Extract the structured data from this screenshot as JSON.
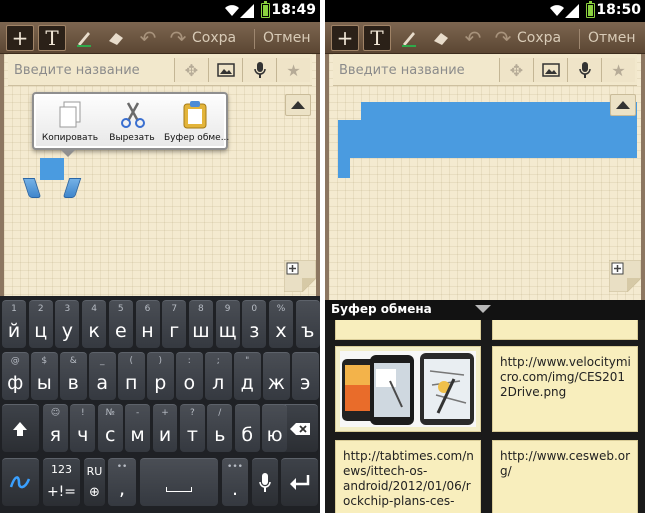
{
  "status_left": {
    "time": "18:49"
  },
  "status_right": {
    "time": "18:50"
  },
  "toolbar": {
    "add_icon": "plus-icon",
    "text_icon": "text-tool-icon",
    "pen_icon": "pen-icon",
    "eraser_icon": "eraser-icon",
    "undo_icon": "undo-icon",
    "redo_icon": "redo-icon",
    "save_label": "Сохра",
    "cancel_label": "Отмен"
  },
  "title_input": {
    "placeholder": "Введите название"
  },
  "title_icons": [
    "move-icon",
    "image-icon",
    "microphone-icon",
    "star-icon"
  ],
  "context_menu": {
    "items": [
      {
        "label": "Копировать",
        "icon": "copy-icon"
      },
      {
        "label": "Вырезать",
        "icon": "scissors-icon"
      },
      {
        "label": "Буфер обме...",
        "icon": "clipboard-icon"
      }
    ]
  },
  "keyboard": {
    "row1": [
      {
        "hint": "1",
        "key": "й"
      },
      {
        "hint": "2",
        "key": "ц"
      },
      {
        "hint": "3",
        "key": "у"
      },
      {
        "hint": "4",
        "key": "к"
      },
      {
        "hint": "5",
        "key": "е"
      },
      {
        "hint": "6",
        "key": "н"
      },
      {
        "hint": "7",
        "key": "г"
      },
      {
        "hint": "8",
        "key": "ш"
      },
      {
        "hint": "9",
        "key": "щ"
      },
      {
        "hint": "0",
        "key": "з"
      },
      {
        "hint": "%",
        "key": "х"
      },
      {
        "hint": "",
        "key": "ъ"
      }
    ],
    "row2": [
      {
        "hint": "@",
        "key": "ф"
      },
      {
        "hint": "$",
        "key": "ы"
      },
      {
        "hint": "&",
        "key": "в"
      },
      {
        "hint": "_",
        "key": "а"
      },
      {
        "hint": "(",
        "key": "п"
      },
      {
        "hint": ")",
        "key": "р"
      },
      {
        "hint": ":",
        "key": "о"
      },
      {
        "hint": ";",
        "key": "л"
      },
      {
        "hint": "\"",
        "key": "д"
      },
      {
        "hint": "",
        "key": "ж"
      },
      {
        "hint": "",
        "key": "э"
      }
    ],
    "row3": [
      {
        "hint": "☺",
        "key": "я"
      },
      {
        "hint": "!",
        "key": "ч"
      },
      {
        "hint": "№",
        "key": "с"
      },
      {
        "hint": "-",
        "key": "м"
      },
      {
        "hint": "+",
        "key": "и"
      },
      {
        "hint": "?",
        "key": "т"
      },
      {
        "hint": "/",
        "key": "ь"
      },
      {
        "hint": "",
        "key": "б"
      },
      {
        "hint": "",
        "key": "ю"
      }
    ],
    "symbols_top": "123",
    "symbols_bottom": "+!=",
    "lang": "RU",
    "comma": ",",
    "period": "."
  },
  "clipboard": {
    "title": "Буфер обмена",
    "card_url1": "http://www.velocitymicro.com/img/CES2012Drive.png",
    "card_url2": "http://tabtimes.com/news/ittech-os-android/2012/01/06/rockchip-plans-ces-",
    "card_url3": "http://www.cesweb.org/"
  },
  "colors": {
    "selection": "#4a9be0",
    "note_bg": "#f4ead0",
    "clip_card": "#f8eebd"
  }
}
